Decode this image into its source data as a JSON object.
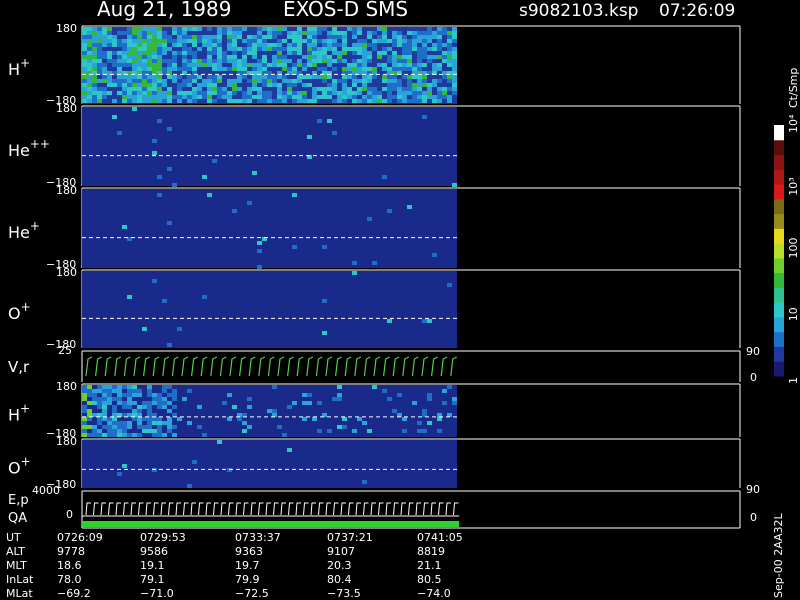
{
  "header": {
    "date": "Aug 21, 1989",
    "instrument": "EXOS-D SMS",
    "file": "s9082103.ksp",
    "time": "07:26:09"
  },
  "colorbar": {
    "unit_label": "Ct/Smp",
    "scale": "log",
    "range": [
      1,
      10000
    ],
    "ticks": [
      "1",
      "10",
      "100",
      "10³",
      "10⁴"
    ],
    "colors": [
      "#1a1a6e",
      "#1e3a9c",
      "#1f6ec8",
      "#2aa3d8",
      "#2fc6c8",
      "#2fc090",
      "#35b83a",
      "#6ccf2a",
      "#b8e02a",
      "#e6d81a",
      "#9a8a1a",
      "#7a6a1a",
      "#d81a1a",
      "#b01818",
      "#8a1414",
      "#5a0e0e",
      "#ffffff"
    ]
  },
  "chart_data": [
    {
      "type": "heatmap",
      "species": "H",
      "charge": "+",
      "ylim": [
        -180,
        180
      ],
      "yticks": [
        "180",
        "−180"
      ],
      "data_extent_fraction": 0.57,
      "intensity": "high"
    },
    {
      "type": "heatmap",
      "species": "He",
      "charge": "++",
      "ylim": [
        -180,
        180
      ],
      "yticks": [
        "180",
        "−180"
      ],
      "data_extent_fraction": 0.57,
      "intensity": "low"
    },
    {
      "type": "heatmap",
      "species": "He",
      "charge": "+",
      "ylim": [
        -180,
        180
      ],
      "yticks": [
        "180",
        "−180"
      ],
      "data_extent_fraction": 0.57,
      "intensity": "low"
    },
    {
      "type": "heatmap",
      "species": "O",
      "charge": "+",
      "ylim": [
        -180,
        180
      ],
      "yticks": [
        "180",
        "−180"
      ],
      "data_extent_fraction": 0.57,
      "intensity": "low"
    },
    {
      "type": "line",
      "label": "V,r",
      "left_tick": "25",
      "right_ticks": [
        "90",
        "0"
      ]
    },
    {
      "type": "heatmap",
      "species": "H",
      "charge": "+",
      "ylim": [
        -180,
        180
      ],
      "yticks": [
        "180",
        "−180"
      ],
      "data_extent_fraction": 0.57,
      "intensity": "medium"
    },
    {
      "type": "heatmap",
      "species": "O",
      "charge": "+",
      "ylim": [
        -180,
        180
      ],
      "yticks": [
        "180",
        "−180"
      ],
      "data_extent_fraction": 0.57,
      "intensity": "low"
    },
    {
      "type": "line",
      "label": "E,p",
      "label2": "QA",
      "left_ticks": [
        "4000",
        "0"
      ],
      "right_ticks": [
        "90",
        "0"
      ]
    }
  ],
  "ephemeris": {
    "rows": [
      {
        "label": "UT",
        "values": [
          "0726:09",
          "0729:53",
          "0733:37",
          "0737:21",
          "0741:05"
        ]
      },
      {
        "label": "ALT",
        "values": [
          "9778",
          "9586",
          "9363",
          "9107",
          "8819"
        ]
      },
      {
        "label": "MLT",
        "values": [
          "18.6",
          "19.1",
          "19.7",
          "20.3",
          "21.1"
        ]
      },
      {
        "label": "InLat",
        "values": [
          "78.0",
          "79.1",
          "79.9",
          "80.4",
          "80.5"
        ]
      },
      {
        "label": "MLat",
        "values": [
          "−69.2",
          "−71.0",
          "−72.5",
          "−73.5",
          "−74.0"
        ]
      }
    ]
  },
  "footer": {
    "code": "Sep-00 2AA32L"
  }
}
